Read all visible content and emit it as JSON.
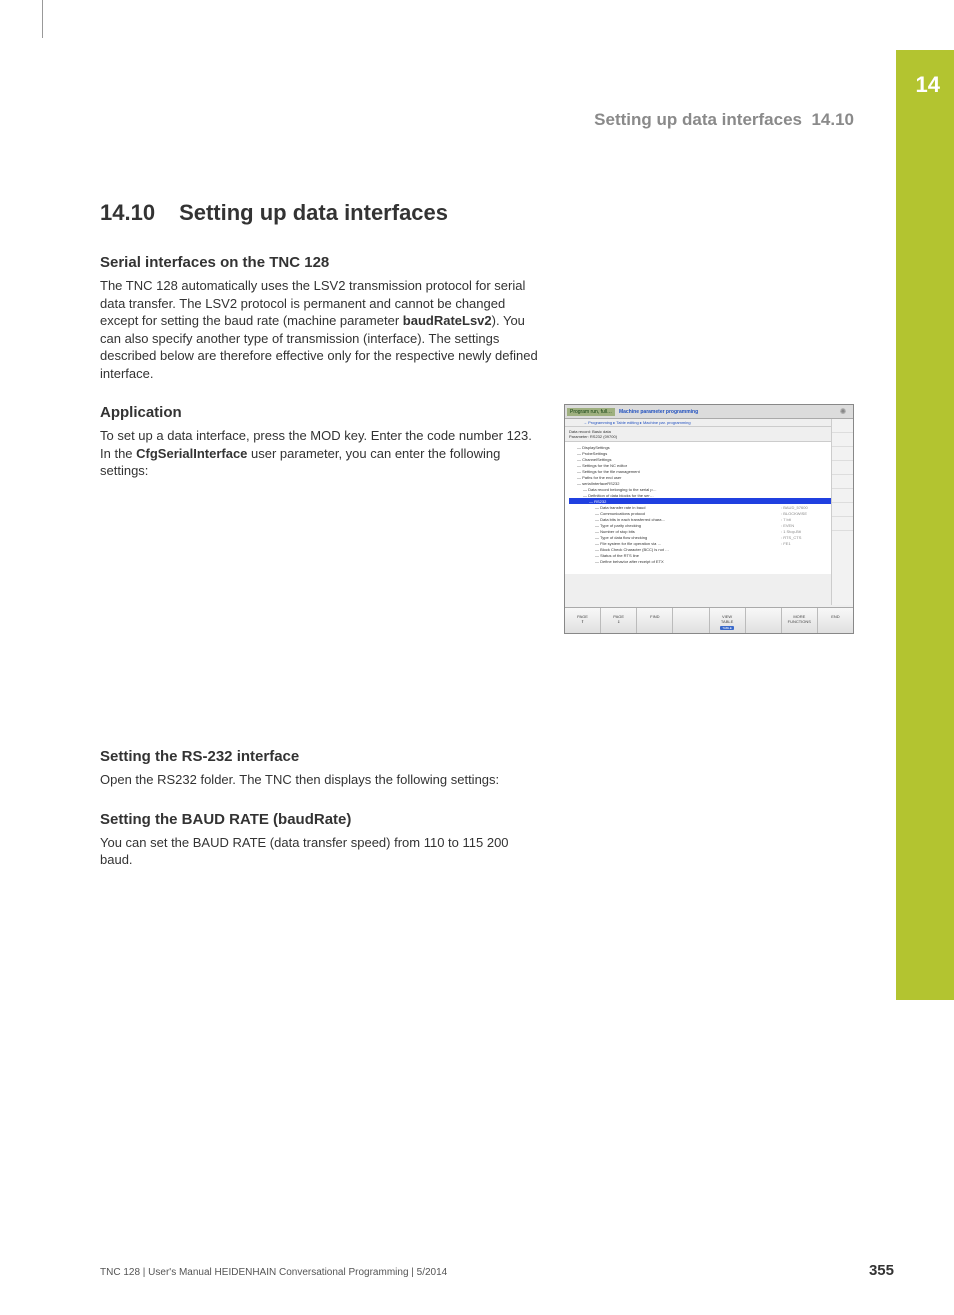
{
  "chapter_tab": "14",
  "header": {
    "title": "Setting up data interfaces",
    "section": "14.10"
  },
  "main_heading": {
    "number": "14.10",
    "text": "Setting up data interfaces"
  },
  "section1": {
    "heading": "Serial interfaces on the TNC 128",
    "p1a": "The TNC 128 automatically uses the LSV2 transmission protocol for serial data transfer. The LSV2 protocol is permanent and cannot be changed except for setting the baud rate (machine parameter ",
    "p1b_bold": "baudRateLsv2",
    "p1c": "). You can also specify another type of transmission (interface). The settings described below are therefore effective only for the respective newly defined interface."
  },
  "section2": {
    "heading": "Application",
    "p1a": "To set up a data interface, press the MOD key. Enter the code number 123. In the ",
    "p1b_bold": "CfgSerialInterface",
    "p1c": " user parameter, you can enter the following settings:"
  },
  "screenshot": {
    "top1": "Program run, full…",
    "top2": "Machine parameter programming",
    "sub": "→ Programming ▸ Table editing ▸ Machine par. programming",
    "info1": "Data record: Basic data",
    "info2": "Parameter: RS232 (09700)",
    "rows": [
      {
        "indent": 1,
        "label": "DisplaySettings",
        "val": ""
      },
      {
        "indent": 1,
        "label": "ProbeSettings",
        "val": ""
      },
      {
        "indent": 1,
        "label": "ChannelSettings",
        "val": ""
      },
      {
        "indent": 1,
        "label": "Settings for the NC editor",
        "val": ""
      },
      {
        "indent": 1,
        "label": "Settings for the file management",
        "val": ""
      },
      {
        "indent": 1,
        "label": "Paths for the end user",
        "val": ""
      },
      {
        "indent": 1,
        "label": "serialInterfaceRS232",
        "val": ""
      },
      {
        "indent": 2,
        "label": "Data record belonging to the serial p…",
        "val": ""
      },
      {
        "indent": 2,
        "label": "Definition of data blocks for the ser…",
        "val": ""
      },
      {
        "indent": 3,
        "label": "RS232",
        "val": "",
        "hl": true
      },
      {
        "indent": 4,
        "label": "Data transfer rate in baud",
        "val": ": BAUD_57600"
      },
      {
        "indent": 4,
        "label": "Communications protocol",
        "val": ": BLOCKWISE"
      },
      {
        "indent": 4,
        "label": "Data bits in each transferred chara…",
        "val": ": 7 bit"
      },
      {
        "indent": 4,
        "label": "Type of parity checking",
        "val": ": EVEN"
      },
      {
        "indent": 4,
        "label": "Number of stop bits",
        "val": ": 1 Stop-Bit"
      },
      {
        "indent": 4,
        "label": "Type of data flow checking",
        "val": ": RTS_CTS"
      },
      {
        "indent": 4,
        "label": "File system for file operation via …",
        "val": ": FE1"
      },
      {
        "indent": 4,
        "label": "Block Check Character (BCC) is not …",
        "val": ""
      },
      {
        "indent": 4,
        "label": "Status of the RTS line",
        "val": ""
      },
      {
        "indent": 4,
        "label": "Define behavior after receipt of ETX",
        "val": ""
      }
    ],
    "buttons": [
      "PAGE\n⇑",
      "PAGE\n⇓",
      "FIND",
      "",
      "VIEW\nTABLE",
      "",
      "MORE\nFUNCTIONS",
      "END"
    ],
    "table_hl": "TABLE"
  },
  "section3": {
    "heading": "Setting the RS-232 interface",
    "p1": "Open the RS232 folder. The TNC then displays the following settings:"
  },
  "section4": {
    "heading": "Setting the BAUD RATE (baudRate)",
    "p1": "You can set the BAUD RATE (data transfer speed) from 110 to 115 200 baud."
  },
  "footer": {
    "left": "TNC 128 | User's Manual HEIDENHAIN Conversational Programming | 5/2014",
    "page": "355"
  }
}
